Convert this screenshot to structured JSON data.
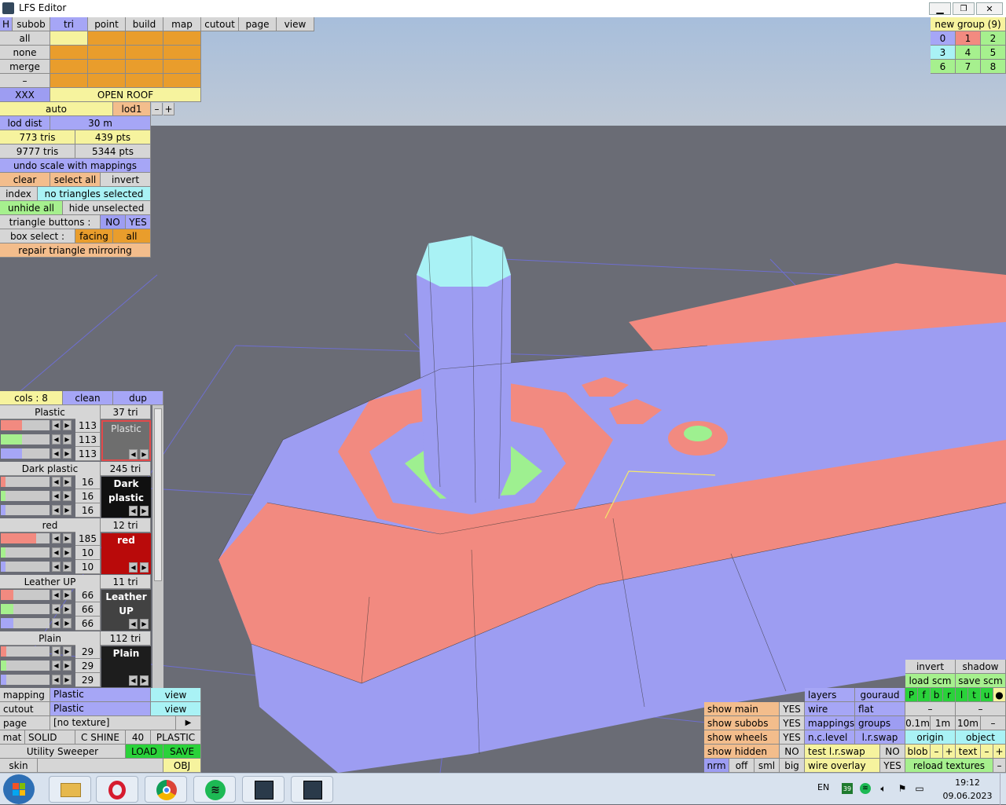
{
  "app": {
    "title": "LFS Editor"
  },
  "top_menu": [
    "subob",
    "tri",
    "point",
    "build",
    "map",
    "cutout",
    "page",
    "view"
  ],
  "top_menu_h": "H",
  "side_rows": [
    "all",
    "none",
    "merge",
    "–"
  ],
  "xxx": "XXX",
  "subobject_name": "OPEN ROOF",
  "lod": {
    "auto": "auto",
    "lod1": "lod1",
    "minus": "–",
    "plus": "+"
  },
  "lod_dist": {
    "label": "lod dist",
    "value": "30 m"
  },
  "counts": {
    "tris": "773 tris",
    "pts": "439 pts",
    "all_tris": "9777 tris",
    "all_pts": "5344 pts"
  },
  "undo": "undo scale with mappings",
  "sel_row": [
    "clear",
    "select all",
    "invert"
  ],
  "index": {
    "label": "index",
    "value": "no triangles selected"
  },
  "hide_row": [
    "unhide all",
    "hide unselected"
  ],
  "tri_buttons": {
    "label": "triangle buttons :",
    "no": "NO",
    "yes": "YES"
  },
  "box_select": {
    "label": "box select :",
    "facing": "facing",
    "all": "all"
  },
  "repair": "repair triangle mirroring",
  "groups": {
    "title": "new group (9)",
    "cells": [
      "0",
      "1",
      "2",
      "3",
      "4",
      "5",
      "6",
      "7",
      "8"
    ],
    "colors": [
      "#a6a6f6",
      "#f28a80",
      "#a6f08e",
      "#a9f2f5",
      "#a6f08e",
      "#a6f08e",
      "#a6f08e",
      "#a6f08e",
      "#a6f08e"
    ]
  },
  "cols_bar": {
    "cols": "cols : 8",
    "clean": "clean",
    "dup": "dup"
  },
  "materials": [
    {
      "name": "Plastic",
      "tri": "37 tri",
      "r": "113",
      "g": "113",
      "b": "113",
      "swatch": "#6e6e6e",
      "text": "#ffffff",
      "label": "Plastic",
      "label2": "",
      "r_level": 0.44,
      "g_level": 0.44,
      "b_level": 0.44
    },
    {
      "name": "Dark plastic",
      "tri": "245 tri",
      "r": "16",
      "g": "16",
      "b": "16",
      "swatch": "#101010",
      "text": "#ffffff",
      "label": "Dark",
      "label2": "plastic",
      "r_level": 0.06,
      "g_level": 0.06,
      "b_level": 0.06
    },
    {
      "name": "red",
      "tri": "12 tri",
      "r": "185",
      "g": "10",
      "b": "10",
      "swatch": "#b90a0a",
      "text": "#ffffff",
      "label": "red",
      "label2": "",
      "r_level": 0.73,
      "g_level": 0.04,
      "b_level": 0.04
    },
    {
      "name": "Leather UP",
      "tri": "11 tri",
      "r": "66",
      "g": "66",
      "b": "66",
      "swatch": "#424242",
      "text": "#ffffff",
      "label": "Leather",
      "label2": "UP",
      "r_level": 0.26,
      "g_level": 0.26,
      "b_level": 0.26
    },
    {
      "name": "Plain",
      "tri": "112 tri",
      "r": "29",
      "g": "29",
      "b": "29",
      "swatch": "#1d1d1d",
      "text": "#ffffff",
      "label": "Plain",
      "label2": "",
      "r_level": 0.11,
      "g_level": 0.11,
      "b_level": 0.11
    }
  ],
  "bottom_left": {
    "mapping": {
      "label": "mapping",
      "value": "Plastic",
      "btn": "view"
    },
    "cutout": {
      "label": "cutout",
      "value": "Plastic",
      "btn": "view"
    },
    "page": {
      "label": "page",
      "value": "[no texture]",
      "btn": "▶"
    },
    "mat": {
      "label": "mat",
      "solid": "SOLID",
      "shine": "C SHINE",
      "num": "40",
      "kind": "PLASTIC"
    },
    "file": {
      "name": "Utility Sweeper",
      "load": "LOAD",
      "save": "SAVE"
    },
    "skin": {
      "label": "skin",
      "obj": "OBJ"
    }
  },
  "bottom_right": {
    "invert": "invert",
    "shadow": "shadow",
    "load_scm": "load scm",
    "save_scm": "save scm",
    "pfbrltu": [
      "P",
      "f",
      "b",
      "r",
      "l",
      "t",
      "u",
      "●"
    ],
    "layers": "layers",
    "gouraud": "gouraud",
    "wire": "wire",
    "flat": "flat",
    "mappings": "mappings",
    "groups": "groups",
    "nclevel": "n.c.level",
    "lrswap": "l.r.swap",
    "show_main": "show main",
    "show_subobs": "show subobs",
    "show_wheels": "show wheels",
    "show_hidden": "show hidden",
    "yes": "YES",
    "no": "NO",
    "test_lrswap": "test l.r.swap",
    "nrm": "nrm",
    "off": "off",
    "sml": "sml",
    "big": "big",
    "wire_overlay": "wire overlay",
    "dash": "–",
    "scales": [
      "0.1m",
      "1m",
      "10m"
    ],
    "origin": "origin",
    "object": "object",
    "blob": "blob",
    "text": "text",
    "minus": "–",
    "plus": "+",
    "reload": "reload textures"
  },
  "taskbar": {
    "lang": "EN",
    "badge": "39",
    "time": "19:12",
    "date": "09.06.2023"
  }
}
